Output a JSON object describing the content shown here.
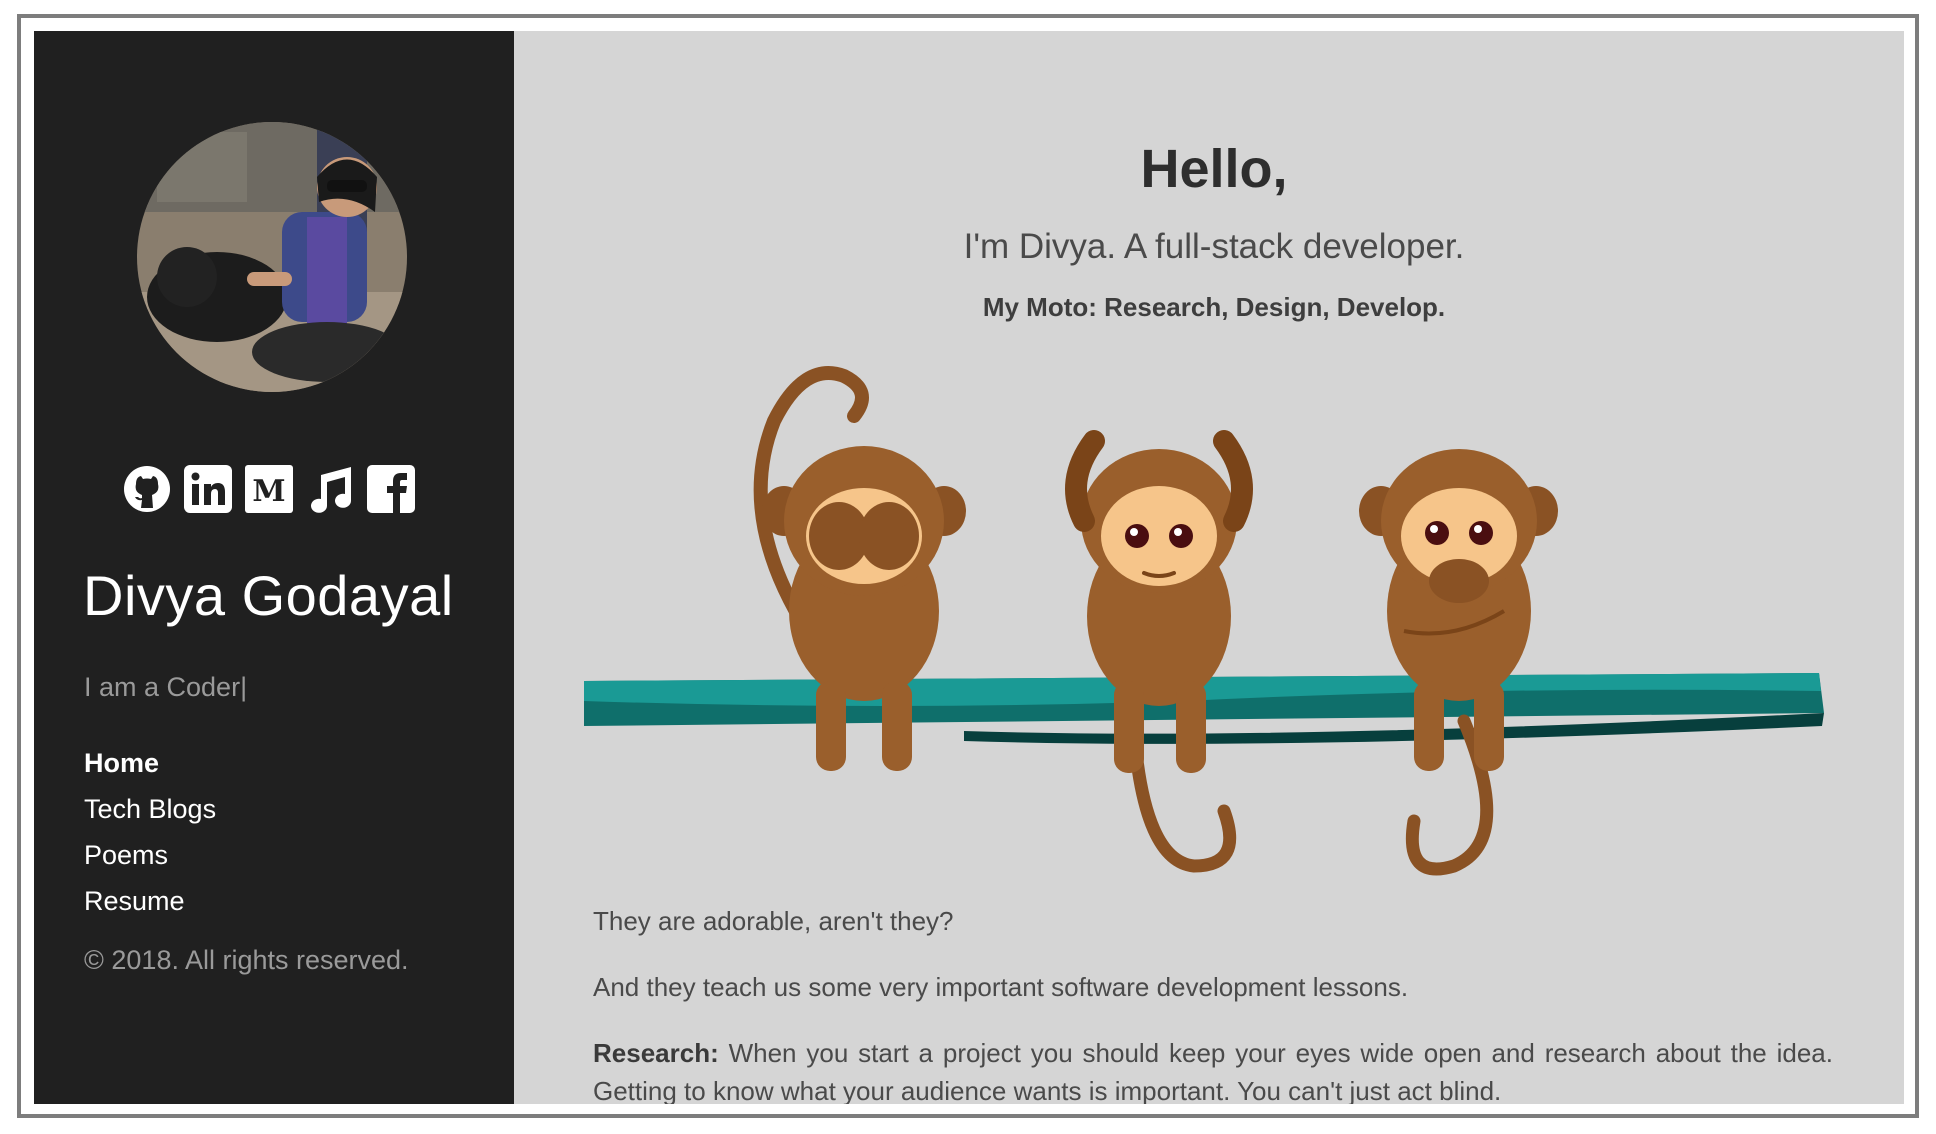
{
  "sidebar": {
    "name": "Divya Godayal",
    "tagline": "I am a Coder|",
    "social": [
      "github-icon",
      "linkedin-icon",
      "medium-icon",
      "music-icon",
      "facebook-icon"
    ],
    "nav": [
      {
        "label": "Home",
        "active": true
      },
      {
        "label": "Tech Blogs",
        "active": false
      },
      {
        "label": "Poems",
        "active": false
      },
      {
        "label": "Resume",
        "active": false
      }
    ],
    "copyright": "© 2018. All rights reserved."
  },
  "main": {
    "greeting": "Hello,",
    "intro": "I'm Divya. A full-stack developer.",
    "moto": "My Moto: Research, Design, Develop.",
    "para1": "They are adorable, aren't they?",
    "para2": "And they teach us some very important software development lessons.",
    "para3_label": "Research:",
    "para3_text": " When you start a project you should keep your eyes wide open and research about the idea. Getting to know what your audience wants is important. You can't just act blind."
  },
  "colors": {
    "sidebar_bg": "#202020",
    "main_bg": "#d5d5d5",
    "branch": "#0f6f6b",
    "monkey_body": "#9a5f2c",
    "monkey_face": "#f6c58a"
  }
}
